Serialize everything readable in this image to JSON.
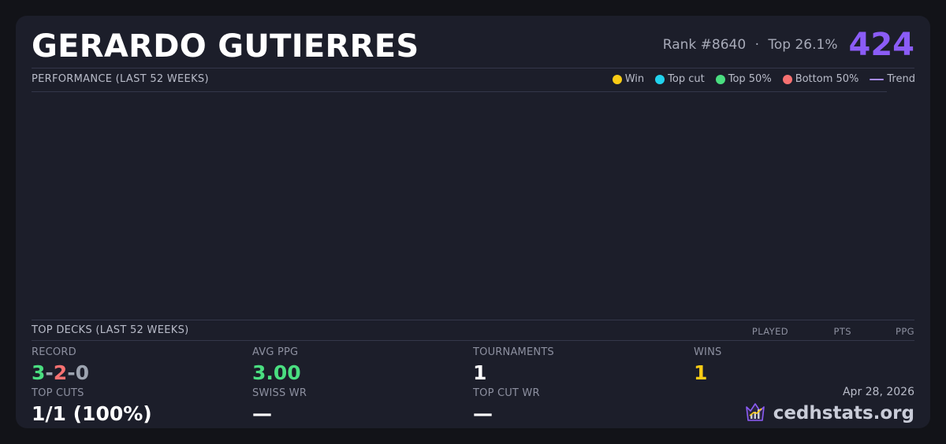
{
  "header": {
    "player_name": "GERARDO GUTIERRES",
    "rank": "Rank #8640",
    "separator": "·",
    "percentile": "Top 26.1%",
    "score": "424"
  },
  "performance": {
    "title": "PERFORMANCE (LAST 52 WEEKS)",
    "legend": [
      {
        "label": "Win",
        "color": "#facc15"
      },
      {
        "label": "Top cut",
        "color": "#22d3ee"
      },
      {
        "label": "Top 50%",
        "color": "#4ade80"
      },
      {
        "label": "Bottom 50%",
        "color": "#f87171"
      },
      {
        "label": "Trend",
        "color": "#a78bfa"
      }
    ]
  },
  "top_decks": {
    "title": "TOP DECKS (LAST 52 WEEKS)",
    "columns": [
      "PLAYED",
      "PTS",
      "PPG"
    ]
  },
  "stats": {
    "record": {
      "label": "RECORD",
      "wins": "3",
      "losses": "2",
      "draws": "0",
      "dash": "-"
    },
    "avg_ppg": {
      "label": "AVG PPG",
      "value": "3.00"
    },
    "tournaments": {
      "label": "TOURNAMENTS",
      "value": "1"
    },
    "wins": {
      "label": "WINS",
      "value": "1"
    },
    "top_cuts": {
      "label": "TOP CUTS",
      "value": "1/1 (100%)"
    },
    "swiss_wr": {
      "label": "SWISS WR",
      "value": "—"
    },
    "top_cut_wr": {
      "label": "TOP CUT WR",
      "value": "—"
    }
  },
  "footer": {
    "date": "Apr 28, 2026",
    "brand": "cedhstats.org",
    "brand_icon": "crown-chart-icon"
  },
  "colors": {
    "accent": "#8b5cf6",
    "background": "#1c1e2a"
  }
}
